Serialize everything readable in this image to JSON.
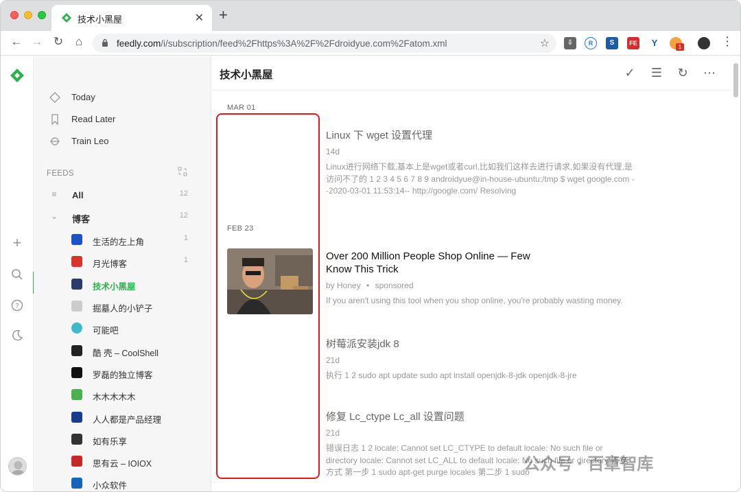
{
  "browser": {
    "tab_title": "技术小黑屋",
    "tab_close": "✕",
    "new_tab": "+",
    "url_host": "feedly.com",
    "url_path": "/i/subscription/feed%2Fhttps%3A%2F%2Fdroidyue.com%2Fatom.xml",
    "extension_badge": "1"
  },
  "colors": {
    "feedly_green": "#2bb24c",
    "highlight_red": "#e8151b"
  },
  "nav": {
    "today": "Today",
    "read_later": "Read Later",
    "train": "Train Leo"
  },
  "feeds": {
    "header": "FEEDS",
    "all_label": "All",
    "all_count": "12",
    "group_label": "博客",
    "group_count": "12",
    "subscriptions": [
      {
        "name": "生活的左上角",
        "count": "1",
        "color": "#1e50c8"
      },
      {
        "name": "月光博客",
        "count": "1",
        "color": "#d9342b"
      },
      {
        "name": "技术小黑屋",
        "count": "",
        "color": "#2a3a6a"
      },
      {
        "name": "掘墓人的小铲子",
        "count": "",
        "color": "#cccccc"
      },
      {
        "name": "可能吧",
        "count": "",
        "color": "#3fb8c8"
      },
      {
        "name": "酷 壳 – CoolShell",
        "count": "",
        "color": "#222222"
      },
      {
        "name": "罗磊的独立博客",
        "count": "",
        "color": "#111111"
      },
      {
        "name": "木木木木木",
        "count": "",
        "color": "#4caf50"
      },
      {
        "name": "人人都是产品经理",
        "count": "",
        "color": "#1a3c8c"
      },
      {
        "name": "如有乐享",
        "count": "",
        "color": "#333333"
      },
      {
        "name": "思有云 – IOIOX",
        "count": "",
        "color": "#c62828"
      },
      {
        "name": "小众软件",
        "count": "",
        "color": "#1565c0"
      }
    ]
  },
  "main": {
    "title": "技术小黑屋",
    "sections": [
      {
        "date": "MAR 01",
        "title": "Linux 下 wget 设置代理",
        "meta": "14d",
        "summary": "Linux进行网络下载,基本上是wget或者curl,比如我们这样去进行请求,如果没有代理,是访问不了的 1 2 3 4 5 6 7 8 9 androidyue@in-house-ubuntu:/tmp $ wget google.com --2020-03-01 11:53:14-- http://google.com/ Resolving"
      },
      {
        "date": "FEB 23",
        "title": "Over 200 Million People Shop Online — Few Know This Trick",
        "meta_by": "by Honey",
        "meta_dot": "•",
        "meta_sponsored": "sponsored",
        "summary": "If you aren't using this tool when you shop online, you're probably wasting money."
      },
      {
        "title": "树莓派安装jdk 8",
        "meta": "21d",
        "summary": "执行 1 2 sudo apt update sudo apt install openjdk-8-jdk openjdk-8-jre"
      },
      {
        "title": "修复 Lc_ctype Lc_all 设置问题",
        "meta": "21d",
        "summary": "错误日志 1 2 locale: Cannot set LC_CTYPE to default locale: No such file or directory locale: Cannot set LC_ALL to default locale: No such file or directory 修复方式 第一步 1 sudo apt-get purge locales 第二步 1 sudo"
      }
    ]
  },
  "watermark": "公众号 · 百章智库"
}
